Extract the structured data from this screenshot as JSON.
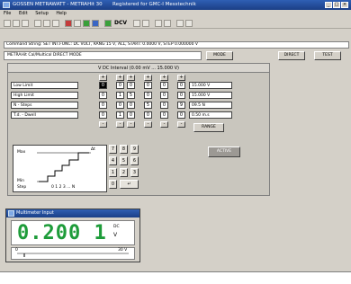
{
  "app": {
    "title": "GOSSEN METRAWATT  -  METRAHit 30",
    "registered": "Registered for GMC-I Messtechnik"
  },
  "menu": [
    "File",
    "Edit",
    "Setup",
    "Help"
  ],
  "toolbar": {
    "unit_label": "DCV"
  },
  "command": {
    "label": "Command String:",
    "text": "SET INT.FUNC: DC VOLT, RANG 15 V, ALL, START:  0.0000 V, STEP 0.000000 V"
  },
  "mode": {
    "value": "METRAHit Cal/Multical  DIRECT MODE",
    "mode_button": "MODE",
    "direct_button": "DIRECT",
    "test_button": "TEST"
  },
  "panel": {
    "title": "V DC  Interval  (0.00 mV ... 15.000 V)",
    "rows": [
      {
        "label": "Low Limit",
        "digits": [
          "0",
          "0",
          "0",
          "0",
          "0",
          "0"
        ],
        "value": "15.000 V"
      },
      {
        "label": "High Limit",
        "digits": [
          "0",
          "1",
          "5",
          "0",
          "0",
          "0"
        ],
        "value": "15.000 V"
      },
      {
        "label": "N - Steps",
        "digits": [
          "0",
          "0",
          "0",
          "5",
          "0",
          "9"
        ],
        "value": "09.5 N"
      },
      {
        "label": "T.d. - Dwell",
        "digits": [
          "0",
          "1",
          "0",
          "0",
          "0",
          "0"
        ],
        "value": "0.50 m.s"
      }
    ],
    "range_button": "RANGE",
    "active_button": "ACTIVE",
    "graph": {
      "max": "Max",
      "min": "Min",
      "step": "Step",
      "ticks": "0 1 2 3 ... N",
      "dt": "Δt"
    }
  },
  "keypad": [
    "7",
    "8",
    "9",
    "4",
    "5",
    "6",
    "1",
    "2",
    "3",
    "0",
    "↵"
  ],
  "dmm": {
    "title": "Multimeter Input",
    "reading": "0.200 1",
    "unit_top": "DC",
    "unit": "V",
    "scale_left": "0",
    "scale_right": "30 V"
  }
}
